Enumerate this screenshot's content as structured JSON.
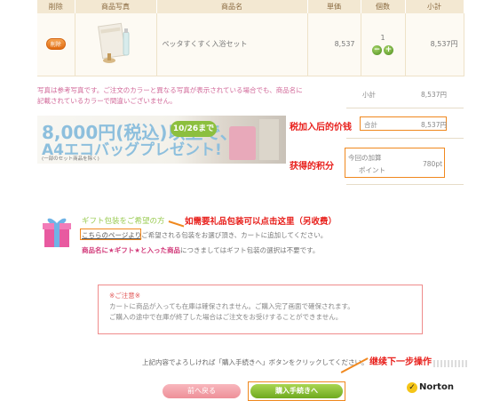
{
  "cart": {
    "headers": [
      "削除",
      "商品写真",
      "商品名",
      "単価",
      "個数",
      "小計"
    ],
    "row": {
      "delete_label": "削除",
      "name": "ペッタすくすく入浴セット",
      "unit_price": "8,537",
      "quantity": "1",
      "subtotal": "8,537円"
    }
  },
  "photo_note": "写真は参考写真です。ご注文のカラーと異なる写真が表示されている場合でも、商品名に記載されているカラーで間違いございません。",
  "summary": {
    "subtotal_label": "小計",
    "subtotal_value": "8,537円",
    "total_label": "合計",
    "total_value": "8,537円",
    "points_label_1": "今回の加算",
    "points_label_2": "ポイント",
    "points_value": "780pt"
  },
  "banner": {
    "line1": "8,000円(税込)以上で、",
    "date": "10/26まで",
    "line2": "A4エコバッグプレゼント!",
    "small": "(一部のセット商品を除く)"
  },
  "annotations": {
    "total_after_tax": "税加入后的价钱",
    "points_earned": "获得的积分",
    "gift_wrap": "如需要礼品包装可以点击这里（另收费）",
    "next_step": "继续下一步操作"
  },
  "gift": {
    "title": "ギフト包装をご希望の方",
    "link": "こちらのページより",
    "line2_rest": "ご希望される包装をお選び頂き、カートに追加してください。",
    "line3_pink": "商品名に★ギフト★と入った商品",
    "line3_rest": "につきましてはギフト包装の選択は不要です。"
  },
  "caution": {
    "title": "※ご注意※",
    "line1": "カートに商品が入っても在庫は確保されません。ご購入完了画面で確保されます。",
    "line2": "ご購入の途中で在庫が終了した場合はご注文をお受けすることができません。"
  },
  "footer": {
    "instruction": "上記内容でよろしければ「購入手続きへ」ボタンをクリックしてください。",
    "back_label": "前へ戻る",
    "next_label": "購入手続きへ",
    "norton_label": "Norton"
  },
  "colors": {
    "accent_orange": "#f0881e",
    "annotation_red": "#e8201c",
    "green_button": "#7ab52a",
    "pink_button": "#f2a0a8"
  }
}
